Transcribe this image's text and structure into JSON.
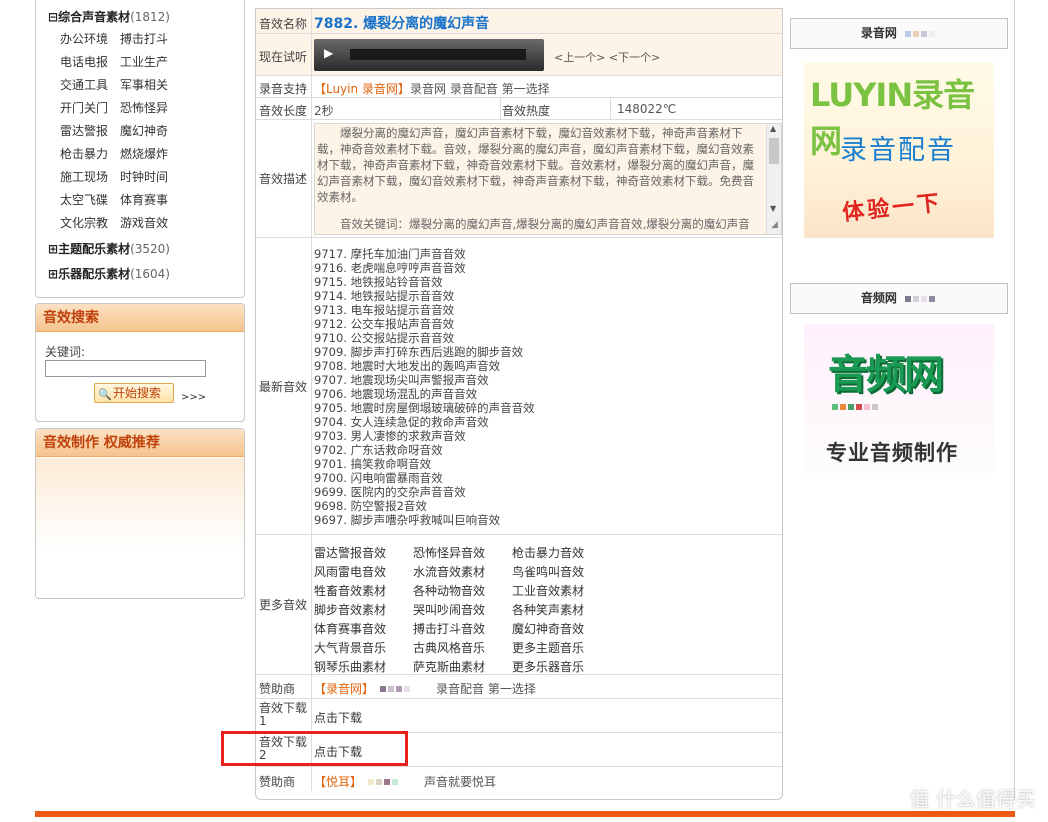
{
  "categories": {
    "main": {
      "label": "综合声音素材",
      "count": "(1812)",
      "expand": "⊟"
    },
    "sub_items": [
      "办公环境",
      "搏击打斗",
      "电话电报",
      "工业生产",
      "交通工具",
      "军事相关",
      "开门关门",
      "恐怖怪异",
      "雷达警报",
      "魔幻神奇",
      "枪击暴力",
      "燃烧爆炸",
      "施工现场",
      "时钟时间",
      "太空飞碟",
      "体育赛事",
      "文化宗教",
      "游戏音效"
    ],
    "theme": {
      "label": "主题配乐素材",
      "count": "(3520)",
      "expand": "⊞"
    },
    "instrument": {
      "label": "乐器配乐素材",
      "count": "(1604)",
      "expand": "⊞"
    }
  },
  "search": {
    "title": "音效搜索",
    "keyword_label": "关键词:",
    "keyword_value": "",
    "button_label": "开始搜索",
    "more": ">>>"
  },
  "recommend": {
    "title": "音效制作 权威推荐"
  },
  "detail": {
    "name_label": "音效名称",
    "name_value": "7882. 爆裂分离的魔幻声音",
    "preview_label": "现在试听",
    "prev_next": "<上一个> <下一个>",
    "support_label": "录音支持",
    "support_brand": "【Luyin 录音网】",
    "support_text": "录音网 录音配音 第一选择",
    "length_label": "音效长度",
    "length_value": "2秒",
    "heat_label": "音效热度",
    "heat_value": "148022℃",
    "desc_label": "音效描述",
    "desc_text": "爆裂分离的魔幻声音，魔幻声音素材下载，魔幻音效素材下载，神奇声音素材下载，神奇音效素材下载。音效，爆裂分离的魔幻声音，魔幻声音素材下载，魔幻音效素材下载，神奇声音素材下载，神奇音效素材下载。音效素材，爆裂分离的魔幻声音，魔幻声音素材下载，魔幻音效素材下载，神奇声音素材下载，神奇音效素材下载。免费音效素材。",
    "desc_keywords": "音效关键词：爆裂分离的魔幻声音,爆裂分离的魔幻声音音效,爆裂分离的魔幻声音",
    "latest_label": "最新音效",
    "latest": [
      "9717. 摩托车加油门声音音效",
      "9716. 老虎喘息哼哼声音音效",
      "9715. 地铁报站铃音音效",
      "9714. 地铁报站提示音音效",
      "9713. 电车报站提示音音效",
      "9712. 公交车报站声音音效",
      "9710. 公交报站提示音音效",
      "9709. 脚步声打碎东西后逃跑的脚步音效",
      "9708. 地震时大地发出的轰鸣声音效",
      "9707. 地震现场尖叫声警报声音效",
      "9706. 地震现场混乱的声音音效",
      "9705. 地震时房屋倒塌玻璃破碎的声音音效",
      "9704. 女人连续急促的救命声音效",
      "9703. 男人凄惨的求救声音效",
      "9702. 广东话救命呀音效",
      "9701. 搞笑救命啊音效",
      "9700. 闪电响雷暴雨音效",
      "9699. 医院内的交杂声音音效",
      "9698. 防空警报2音效",
      "9697. 脚步声嘈杂呼救喊叫巨响音效"
    ],
    "more_label": "更多音效",
    "more_items": [
      "雷达警报音效",
      "恐怖怪异音效",
      "枪击暴力音效",
      "风雨雷电音效",
      "水流音效素材",
      "鸟雀鸣叫音效",
      "牲畜音效素材",
      "各种动物音效",
      "工业音效素材",
      "脚步音效素材",
      "哭叫吵闹音效",
      "各种笑声素材",
      "体育赛事音效",
      "搏击打斗音效",
      "魔幻神奇音效",
      "大气背景音乐",
      "古典风格音乐",
      "更多主题音乐",
      "钢琴乐曲素材",
      "萨克斯曲素材",
      "更多乐器音乐"
    ],
    "sponsor_label": "赞助商",
    "sponsor_brand": "【录音网】",
    "sponsor_text": "录音配音 第一选择",
    "download1_label": "音效下载1",
    "download1_text": "点击下载",
    "download2_label": "音效下载2",
    "download2_text": "点击下载",
    "sponsor2_label": "赞助商",
    "sponsor2_brand": "【悦耳】",
    "sponsor2_text": "声音就要悦耳"
  },
  "ads": {
    "ad1_title": "录音网",
    "ad1_logo": "LUYIN录音网",
    "ad1_slogan": "录音配音",
    "ad1_action": "体验一下",
    "ad2_title": "音频网",
    "ad2_logo": "音频网",
    "ad2_slogan": "专业音频制作"
  },
  "watermark": "值 什么值得买",
  "colors": {
    "accent": "#ec5a14",
    "link": "#1a73c9",
    "highlight_box": "#e8201e"
  }
}
